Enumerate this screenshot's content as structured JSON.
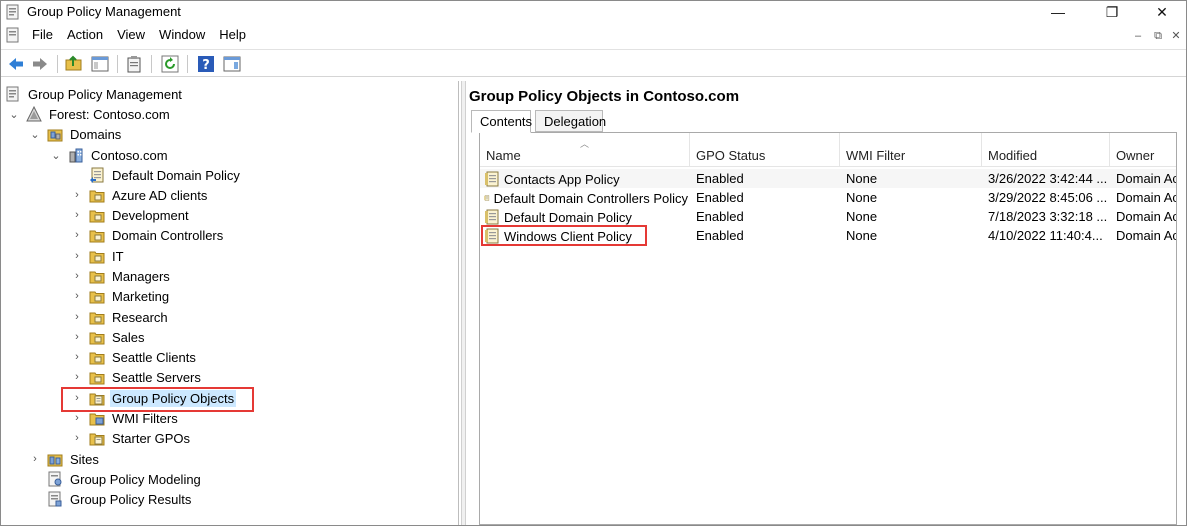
{
  "window": {
    "title": "Group Policy Management"
  },
  "menu": [
    "File",
    "Action",
    "View",
    "Window",
    "Help"
  ],
  "toolbar_icons": [
    "back-icon",
    "forward-icon",
    "up-folder-icon",
    "show-hide-tree-icon",
    "clipboard-icon",
    "refresh-icon",
    "help-icon",
    "action-pane-icon"
  ],
  "tree": {
    "root": "Group Policy Management",
    "forest": "Forest: Contoso.com",
    "domains": "Domains",
    "domain": "Contoso.com",
    "children": [
      "Default Domain Policy",
      "Azure AD clients",
      "Development",
      "Domain Controllers",
      "IT",
      "Managers",
      "Marketing",
      "Research",
      "Sales",
      "Seattle Clients",
      "Seattle Servers",
      "Group Policy Objects",
      "WMI Filters",
      "Starter GPOs"
    ],
    "sites": "Sites",
    "modeling": "Group Policy Modeling",
    "results": "Group Policy Results"
  },
  "details": {
    "heading": "Group Policy Objects in Contoso.com",
    "tabs": [
      "Contents",
      "Delegation"
    ],
    "columns": [
      "Name",
      "GPO Status",
      "WMI Filter",
      "Modified",
      "Owner"
    ],
    "rows": [
      {
        "name": "Contacts App Policy",
        "status": "Enabled",
        "wmi": "None",
        "modified": "3/26/2022 3:42:44 ...",
        "owner": "Domain Ac"
      },
      {
        "name": "Default Domain Controllers Policy",
        "status": "Enabled",
        "wmi": "None",
        "modified": "3/29/2022 8:45:06 ...",
        "owner": "Domain Ac"
      },
      {
        "name": "Default Domain Policy",
        "status": "Enabled",
        "wmi": "None",
        "modified": "7/18/2023 3:32:18 ...",
        "owner": "Domain Ac"
      },
      {
        "name": "Windows Client Policy",
        "status": "Enabled",
        "wmi": "None",
        "modified": "4/10/2022 11:40:4...",
        "owner": "Domain Ac"
      }
    ]
  },
  "colors": {
    "selection": "#cce8ff",
    "highlight_box": "#e53935",
    "folder": "#e8c04a"
  }
}
